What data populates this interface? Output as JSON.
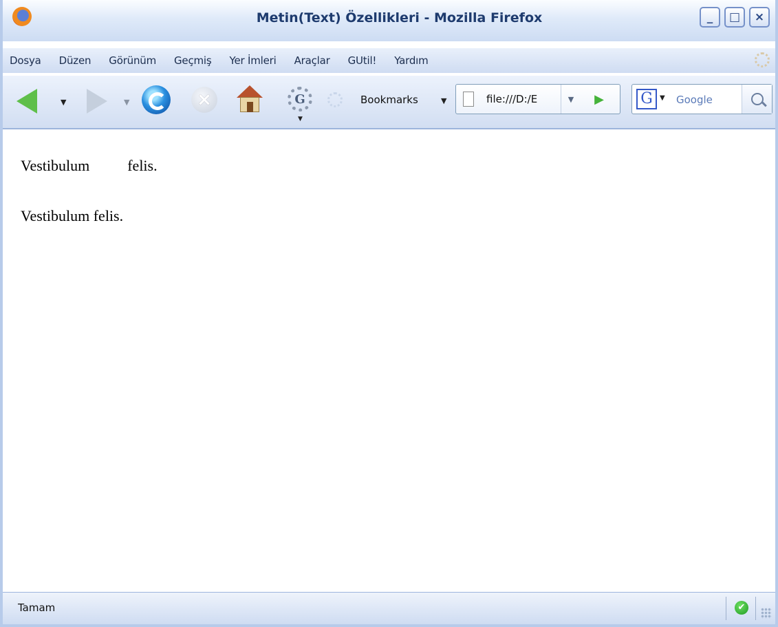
{
  "window": {
    "title": "Metin(Text) Özellikleri - Mozilla Firefox",
    "controls": {
      "minimize": "_",
      "maximize": "□",
      "close": "×"
    }
  },
  "menu": {
    "items": [
      "Dosya",
      "Düzen",
      "Görünüm",
      "Geçmiş",
      "Yer İmleri",
      "Araçlar",
      "GUtil!",
      "Yardım"
    ]
  },
  "toolbar": {
    "icons": {
      "back": "back-arrow-icon",
      "forward": "forward-arrow-icon",
      "reload": "reload-icon",
      "stop": "stop-icon",
      "home": "home-icon",
      "gutil": "gutil-gear-icon",
      "throbber": "throbber-icon"
    },
    "bookmarks_label": "Bookmarks",
    "dropdown_glyph": "▼"
  },
  "urlbar": {
    "value": "file:///D:/E"
  },
  "search": {
    "engine_letter": "G",
    "placeholder": "Google"
  },
  "page": {
    "line1": "Vestibulum          felis.",
    "line2": "Vestibulum felis."
  },
  "status": {
    "text": "Tamam",
    "ok_glyph": "✔"
  },
  "colors": {
    "chrome_light": "#e9f0fb",
    "chrome_dark": "#cfdcf2",
    "title_text": "#1e3b6e",
    "go_green": "#45b33a"
  }
}
